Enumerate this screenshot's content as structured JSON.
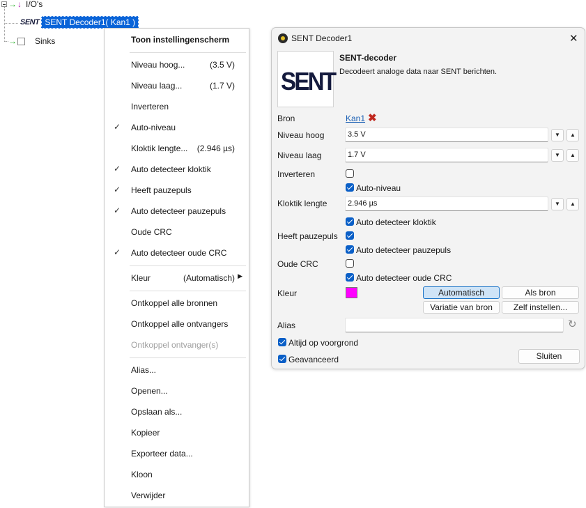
{
  "tree": {
    "ios_label": "I/O's",
    "selected_label": "SENT Decoder1( Kan1 )",
    "sent_icon_text": "SENT",
    "sinks_label": "Sinks"
  },
  "menu": {
    "items": [
      {
        "label": "Toon instellingenscherm",
        "bold": true
      },
      {
        "label": "Niveau hoog...",
        "value": "(3.5 V)"
      },
      {
        "label": "Niveau laag...",
        "value": "(1.7 V)"
      },
      {
        "label": "Inverteren"
      },
      {
        "label": "Auto-niveau",
        "checked": true
      },
      {
        "label": "Kloktik lengte...",
        "value": "(2.946 µs)"
      },
      {
        "label": "Auto detecteer kloktik",
        "checked": true
      },
      {
        "label": "Heeft pauzepuls",
        "checked": true
      },
      {
        "label": "Auto detecteer pauzepuls",
        "checked": true
      },
      {
        "label": "Oude CRC"
      },
      {
        "label": "Auto detecteer oude CRC",
        "checked": true
      },
      {
        "label": "Kleur",
        "value": "(Automatisch)",
        "submenu": true
      },
      {
        "label": "Ontkoppel alle bronnen"
      },
      {
        "label": "Ontkoppel alle ontvangers"
      },
      {
        "label": "Ontkoppel ontvanger(s)",
        "disabled": true
      },
      {
        "label": "Alias..."
      },
      {
        "label": "Openen..."
      },
      {
        "label": "Opslaan als..."
      },
      {
        "label": "Kopieer"
      },
      {
        "label": "Exporteer data..."
      },
      {
        "label": "Kloon"
      },
      {
        "label": "Verwijder"
      }
    ]
  },
  "dialog": {
    "title": "SENT Decoder1",
    "close_glyph": "✕",
    "logo_text": "SENT",
    "heading": "SENT-decoder",
    "description": "Decodeert analoge data naar SENT berichten.",
    "bron_label": "Bron",
    "bron_value": "Kan1",
    "remove_glyph": "✖",
    "niveau_hoog_label": "Niveau hoog",
    "niveau_hoog_value": "3.5 V",
    "niveau_laag_label": "Niveau laag",
    "niveau_laag_value": "1.7 V",
    "inverteren_label": "Inverteren",
    "auto_niveau_label": "Auto-niveau",
    "kloktik_label": "Kloktik lengte",
    "kloktik_value": "2.946 µs",
    "auto_kloktik_label": "Auto detecteer kloktik",
    "pauzepuls_label": "Heeft pauzepuls",
    "auto_pauzepuls_label": "Auto detecteer pauzepuls",
    "oude_crc_label": "Oude CRC",
    "auto_oude_crc_label": "Auto detecteer oude CRC",
    "kleur_label": "Kleur",
    "kleur_color": "#ff00ff",
    "btn_automatisch": "Automatisch",
    "btn_als_bron": "Als bron",
    "btn_variatie": "Variatie van bron",
    "btn_zelf": "Zelf instellen...",
    "alias_label": "Alias",
    "alias_value": "",
    "altijd_label": "Altijd op voorgrond",
    "geavanceerd_label": "Geavanceerd",
    "sluiten_label": "Sluiten",
    "spin_down": "▼",
    "spin_up": "▲",
    "reset_glyph": "↻"
  }
}
